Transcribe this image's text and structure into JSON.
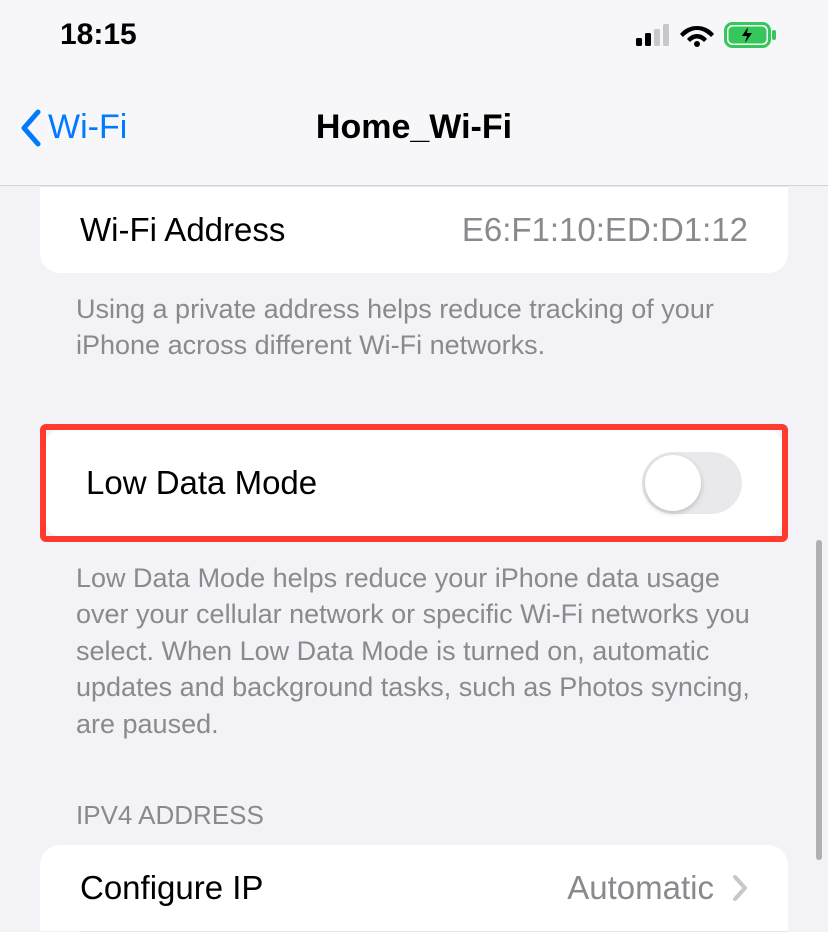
{
  "status": {
    "time": "18:15"
  },
  "nav": {
    "back_label": "Wi-Fi",
    "title": "Home_Wi-Fi"
  },
  "wifi_address": {
    "label": "Wi-Fi Address",
    "value": "E6:F1:10:ED:D1:12"
  },
  "private_address_footer": "Using a private address helps reduce tracking of your iPhone across different Wi-Fi networks.",
  "low_data_mode": {
    "label": "Low Data Mode",
    "enabled": false
  },
  "low_data_mode_footer": "Low Data Mode helps reduce your iPhone data usage over your cellular network or specific Wi-Fi networks you select. When Low Data Mode is turned on, automatic updates and background tasks, such as Photos syncing, are paused.",
  "ipv4": {
    "header": "IPV4 Address",
    "configure_label": "Configure IP",
    "configure_value": "Automatic"
  }
}
